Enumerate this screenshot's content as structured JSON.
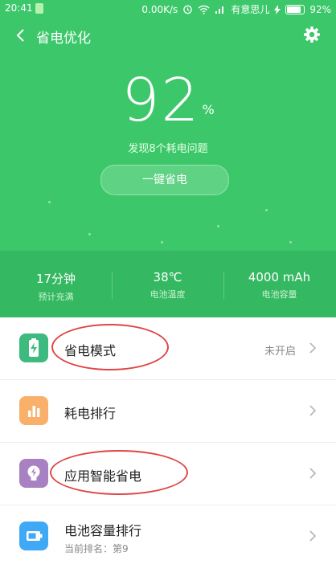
{
  "status_bar": {
    "time": "20:41",
    "net_speed": "0.00K/s",
    "carrier": "有意思儿",
    "battery": "92%"
  },
  "toolbar": {
    "title": "省电优化"
  },
  "battery_panel": {
    "percent": "92",
    "percent_sign": "%",
    "issues": "发现8个耗电问题",
    "button_label": "一键省电"
  },
  "stats": [
    {
      "value": "17分钟",
      "label": "预计充满"
    },
    {
      "value": "38℃",
      "label": "电池温度"
    },
    {
      "value": "4000 mAh",
      "label": "电池容量"
    }
  ],
  "list": [
    {
      "label": "省电模式",
      "value": "未开启",
      "icon": "battery-bolt-icon",
      "color": "#3dbb7e"
    },
    {
      "label": "耗电排行",
      "icon": "bar-chart-icon",
      "color": "#f9b06a"
    },
    {
      "label": "应用智能省电",
      "icon": "bulb-bolt-icon",
      "color": "#a781c1"
    },
    {
      "label": "电池容量排行",
      "sub": "当前排名：第9",
      "icon": "battery-icon",
      "color": "#3fa9f5"
    }
  ],
  "colors": {
    "hero": "#3cc86a",
    "hero_stats": "#35b862",
    "annotation": "#e04545"
  }
}
